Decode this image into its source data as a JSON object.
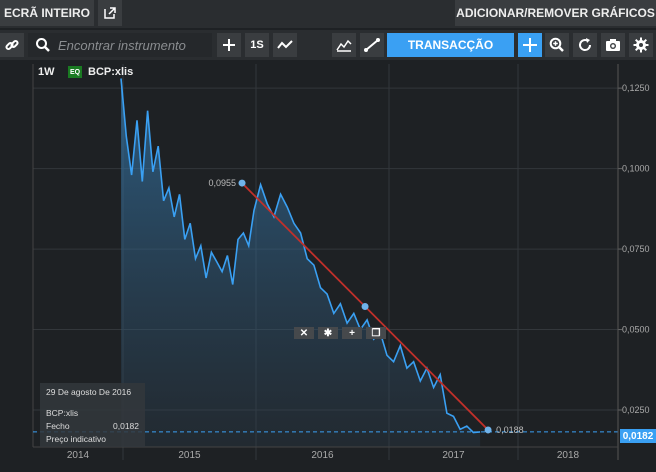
{
  "topbar": {
    "fullscreen_label": "ECRÃ INTEIRO",
    "add_remove_label": "ADICIONAR/REMOVER GRÁFICOS"
  },
  "toolbar": {
    "search_placeholder": "Encontrar instrumento",
    "interval_label": "1S",
    "trade_label": "TRANSACÇÃO"
  },
  "chart_header": {
    "period": "1W",
    "badge": "EQ",
    "symbol": "BCP:xlis"
  },
  "tooltip": {
    "date": "29 De agosto De 2016",
    "symbol": "BCP:xlis",
    "close_label": "Fecho",
    "close_value": "0,0182",
    "indicative_label": "Preço indicativo"
  },
  "trendline": {
    "start_label": "0,0955",
    "end_label": "0,0188"
  },
  "current_price": "0,0182",
  "colors": {
    "accent": "#3aa0f3",
    "trendline": "#c0302a",
    "badge": "#1a7a22"
  },
  "chart_data": {
    "type": "area",
    "x_label": "",
    "y_label": "",
    "y_ticks": [
      "0,1250",
      "0,1000",
      "0,0750",
      "0,0500",
      "0,0250"
    ],
    "x_ticks": [
      "2014",
      "2015",
      "2016",
      "2017",
      "2018"
    ],
    "ylim": [
      0.0135,
      0.1325
    ],
    "series": [
      {
        "x": [
          0,
          0.04,
          0.08,
          0.12,
          0.16,
          0.2,
          0.24,
          0.28,
          0.32,
          0.36,
          0.4,
          0.44,
          0.48,
          0.52,
          0.56,
          0.6,
          0.64,
          0.68,
          0.72,
          0.76,
          0.8,
          0.84,
          0.88,
          0.92,
          0.96,
          1.0,
          1.05,
          1.1,
          1.15,
          1.2,
          1.25,
          1.3,
          1.35,
          1.4,
          1.45,
          1.5,
          1.55,
          1.6,
          1.65,
          1.7,
          1.75,
          1.8,
          1.85,
          1.9,
          1.95,
          2.0,
          2.05,
          2.1,
          2.15,
          2.2,
          2.25,
          2.3,
          2.35,
          2.4,
          2.45,
          2.5,
          2.55,
          2.6,
          2.65,
          2.7
        ],
        "values": [
          0.128,
          0.11,
          0.098,
          0.115,
          0.096,
          0.118,
          0.099,
          0.107,
          0.09,
          0.094,
          0.085,
          0.092,
          0.078,
          0.083,
          0.072,
          0.076,
          0.066,
          0.074,
          0.071,
          0.068,
          0.073,
          0.064,
          0.078,
          0.08,
          0.076,
          0.087,
          0.095,
          0.089,
          0.085,
          0.092,
          0.088,
          0.083,
          0.08,
          0.072,
          0.07,
          0.063,
          0.061,
          0.055,
          0.058,
          0.052,
          0.055,
          0.05,
          0.053,
          0.047,
          0.049,
          0.042,
          0.04,
          0.045,
          0.038,
          0.04,
          0.034,
          0.038,
          0.032,
          0.036,
          0.024,
          0.023,
          0.019,
          0.02,
          0.018,
          0.0182
        ]
      }
    ]
  }
}
